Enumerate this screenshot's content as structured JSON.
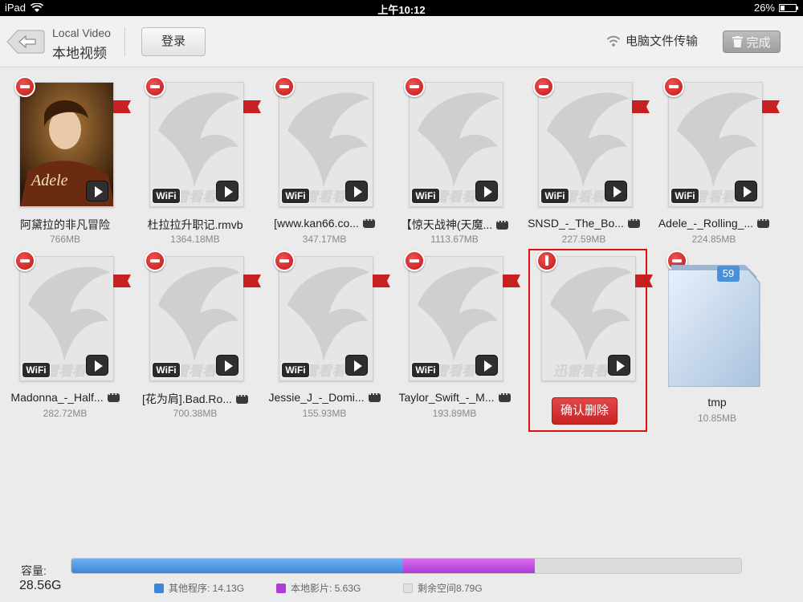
{
  "status": {
    "device": "iPad",
    "time": "上午10:12",
    "battery": "26%",
    "battery_level": 0.26
  },
  "header": {
    "title_en": "Local Video",
    "title_cn": "本地视频",
    "login": "登录",
    "pc_transfer": "电脑文件传输",
    "done": "完成"
  },
  "items": [
    {
      "name": "阿黛拉的非凡冒险",
      "size": "766MB",
      "poster": true,
      "wifi": false,
      "flag": true,
      "more": false
    },
    {
      "name": "杜拉拉升职记.rmvb",
      "size": "1364.18MB",
      "poster": false,
      "wifi": true,
      "flag": true,
      "more": false
    },
    {
      "name": "[www.kan66.co...",
      "size": "347.17MB",
      "poster": false,
      "wifi": true,
      "flag": false,
      "more": true
    },
    {
      "name": "【惊天战神(天魔...",
      "size": "1113.67MB",
      "poster": false,
      "wifi": true,
      "flag": false,
      "more": true
    },
    {
      "name": "SNSD_-_The_Bo...",
      "size": "227.59MB",
      "poster": false,
      "wifi": true,
      "flag": true,
      "more": true
    },
    {
      "name": "Adele_-_Rolling_...",
      "size": "224.85MB",
      "poster": false,
      "wifi": true,
      "flag": true,
      "more": true
    },
    {
      "name": "Madonna_-_Half...",
      "size": "282.72MB",
      "poster": false,
      "wifi": true,
      "flag": true,
      "more": true
    },
    {
      "name": "[花为肩].Bad.Ro...",
      "size": "700.38MB",
      "poster": false,
      "wifi": true,
      "flag": true,
      "more": true
    },
    {
      "name": "Jessie_J_-_Domi...",
      "size": "155.93MB",
      "poster": false,
      "wifi": true,
      "flag": true,
      "more": true
    },
    {
      "name": "Taylor_Swift_-_M...",
      "size": "193.89MB",
      "poster": false,
      "wifi": true,
      "flag": true,
      "more": true
    }
  ],
  "confirm_item": {
    "action": "确认删除"
  },
  "folder": {
    "name": "tmp",
    "size": "10.85MB",
    "count": "59"
  },
  "capacity": {
    "label": "容量:",
    "total": "28.56G",
    "other_label": "其他程序: 14.13G",
    "local_label": "本地影片: 5.63G",
    "free_label": "剩余空间8.79G",
    "other_fraction": 0.495,
    "local_fraction": 0.197,
    "colors": {
      "other": "#3d86d8",
      "local": "#b23ad6",
      "free": "#dcdcdc"
    }
  },
  "watermark": "迅雷看看",
  "wifi_badge": "WiFi"
}
